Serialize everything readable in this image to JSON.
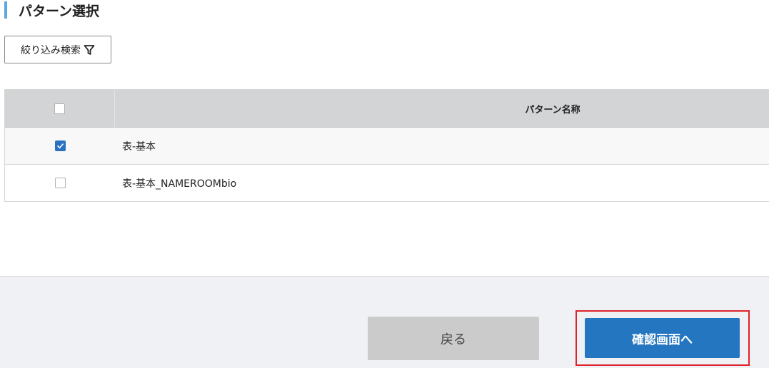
{
  "section": {
    "title": "パターン選択"
  },
  "filter": {
    "label": "絞り込み検索",
    "icon": "filter-icon"
  },
  "table": {
    "columns": {
      "select_all": "",
      "name": "パターン名称"
    },
    "rows": [
      {
        "name": "表-基本",
        "checked": true
      },
      {
        "name": "表-基本_NAMEROOMbio",
        "checked": false
      }
    ]
  },
  "footer": {
    "back_label": "戻る",
    "confirm_label": "確認画面へ"
  },
  "colors": {
    "accent": "#5aa7e0",
    "primary": "#2476c0",
    "checkbox_checked": "#2a72c0",
    "highlight": "#e0222c",
    "back_button": "#cbcbcb"
  }
}
